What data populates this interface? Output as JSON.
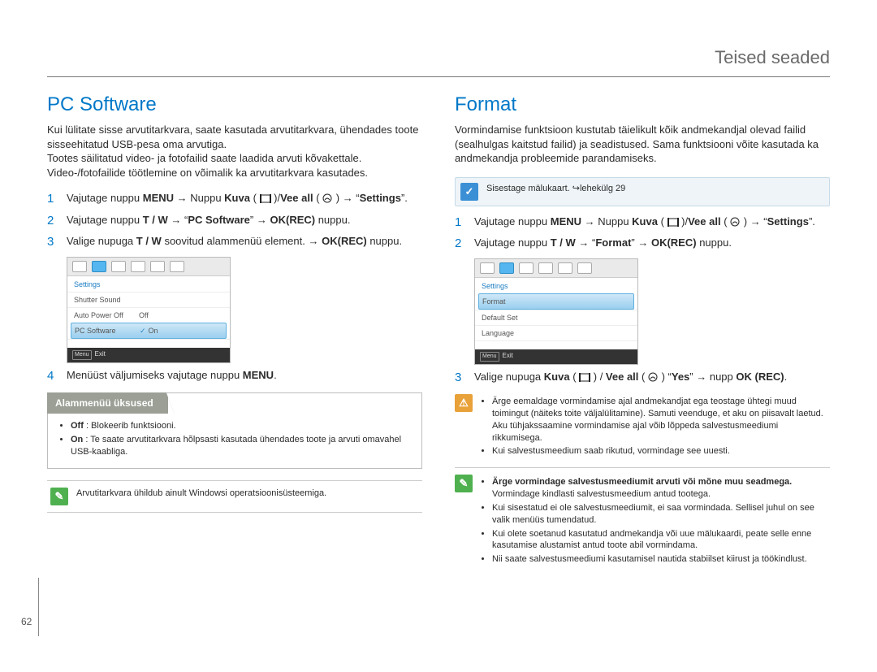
{
  "header": {
    "title": "Teised seaded"
  },
  "page_number": "62",
  "left": {
    "heading": "PC Software",
    "intro": "Kui lülitate sisse arvutitarkvara, saate kasutada arvutitarkvara, ühendades toote sisseehitatud USB-pesa oma arvutiga.\nTootes säilitatud video- ja fotofailid saate laadida arvuti kõvakettale. Video-/fotofailide töötlemine on võimalik ka arvutitarkvara kasutades.",
    "steps": [
      {
        "num": "1",
        "a": "Vajutage nuppu ",
        "b1": "MENU",
        "c": " → Nuppu ",
        "b2": "Kuva",
        "d": " ( ",
        "icon1": "kuva",
        "e": " )/",
        "b3": "Vee all",
        "f": " ( ",
        "icon2": "veeall",
        "g": " ) → “",
        "b4": "Settings",
        "h": "”."
      },
      {
        "num": "2",
        "a": "Vajutage nuppu ",
        "b1": "T / W",
        "c": " → “",
        "b2": "PC Software",
        "d": "” → ",
        "b3": "OK(REC)",
        "e": " nuppu."
      },
      {
        "num": "3",
        "a": "Valige nupuga ",
        "b1": "T / W",
        "c": " soovitud alammenüü element. → ",
        "b2": "OK(REC)",
        "d": " nuppu."
      },
      {
        "num": "4",
        "a": "Menüüst väljumiseks vajutage nuppu ",
        "b1": "MENU",
        "c": "."
      }
    ],
    "shot": {
      "title": "Settings",
      "rows": [
        {
          "label": "Shutter Sound",
          "val": "",
          "sel": false,
          "chk": false
        },
        {
          "label": "Auto Power Off",
          "val": "Off",
          "sel": false,
          "chk": false
        },
        {
          "label": "PC Software",
          "val": "On",
          "sel": true,
          "chk": true
        }
      ],
      "footer_btn": "Menu",
      "footer_text": "Exit"
    },
    "subbox": {
      "title": "Alammenüü üksused",
      "items": [
        {
          "b": "Off",
          "t": " : Blokeerib funktsiooni."
        },
        {
          "b": "On",
          "t": " : Te saate arvutitarkvara hõlpsasti kasutada ühendades toote ja arvuti omavahel USB-kaabliga."
        }
      ]
    },
    "footnote": "Arvutitarkvara ühildub ainult Windowsi operatsioonisüsteemiga."
  },
  "right": {
    "heading": "Format",
    "intro": "Vormindamise funktsioon kustutab täielikult kõik andmekandjal olevad failid (sealhulgas kaitstud failid) ja seadistused. Sama funktsiooni võite kasutada ka andmekandja probleemide parandamiseks.",
    "bluenote": "Sisestage mälukaart. ↪lehekülg 29",
    "steps": [
      {
        "num": "1",
        "a": "Vajutage nuppu ",
        "b1": "MENU",
        "c": " → Nuppu ",
        "b2": "Kuva",
        "d": " ( ",
        "icon1": "kuva",
        "e": " )/",
        "b3": "Vee all",
        "f": " ( ",
        "icon2": "veeall",
        "g": " ) → “",
        "b4": "Settings",
        "h": "”."
      },
      {
        "num": "2",
        "a": "Vajutage nuppu ",
        "b1": "T / W",
        "c": " → “",
        "b2": "Format",
        "d": "” → ",
        "b3": "OK(REC)",
        "e": " nuppu."
      },
      {
        "num": "3",
        "a": "Valige nupuga ",
        "b1": "Kuva",
        "c": " ( ",
        "icon1": "kuva",
        "d": " ) / ",
        "b2": "Vee all",
        "e": " ( ",
        "icon2": "veeall",
        "f": " ) “",
        "b3": "Yes",
        "g": "” → nupp ",
        "b4": "OK (REC)",
        "h": "."
      }
    ],
    "shot": {
      "title": "Settings",
      "rows": [
        {
          "label": "Format",
          "val": "",
          "sel": true,
          "chk": false
        },
        {
          "label": "Default Set",
          "val": "",
          "sel": false,
          "chk": false
        },
        {
          "label": "Language",
          "val": "",
          "sel": false,
          "chk": false
        }
      ],
      "footer_btn": "Menu",
      "footer_text": "Exit"
    },
    "warn": {
      "items": [
        "Ärge eemaldage vormindamise ajal andmekandjat ega teostage ühtegi muud toimingut (näiteks toite väljalülitamine). Samuti veenduge, et aku on piisavalt laetud. Aku tühjakssaamine vormindamise ajal võib lõppeda salvestusmeediumi rikkumisega.",
        "Kui salvestusmeedium saab rikutud, vormindage see uuesti."
      ]
    },
    "pen": {
      "lead": "Ärge vormindage salvestusmeediumit arvuti või mõne muu seadmega.",
      "lead2": "Vormindage kindlasti salvestusmeedium antud tootega.",
      "items": [
        "Kui sisestatud ei ole salvestusmeediumit, ei saa vormindada. Sellisel juhul on see valik menüüs tumendatud.",
        "Kui olete soetanud kasutatud andmekandja või uue mälukaardi, peate selle enne kasutamise alustamist antud toote abil vormindama.",
        "Nii saate salvestusmeediumi kasutamisel nautida stabiilset kiirust ja töökindlust."
      ]
    }
  }
}
